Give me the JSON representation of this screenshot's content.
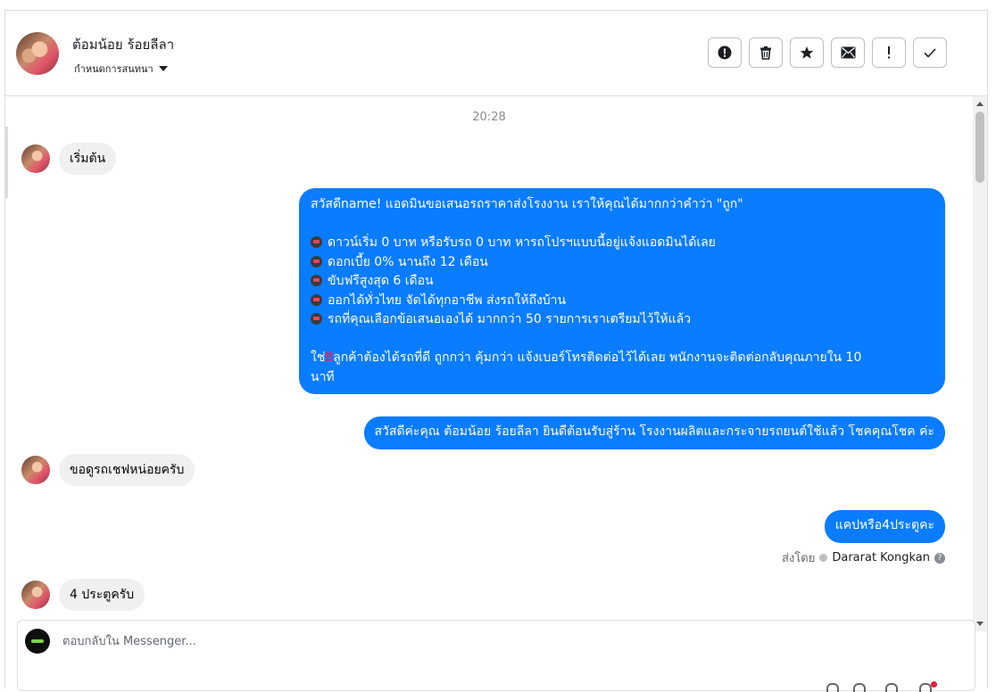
{
  "header": {
    "contact_name": "ต้อมน้อย ร้อยลีลา",
    "assign_label": "กำหนดการสนทนา",
    "actions": [
      {
        "name": "alert-icon"
      },
      {
        "name": "trash-icon"
      },
      {
        "name": "star-icon"
      },
      {
        "name": "mail-icon"
      },
      {
        "name": "exclamation-icon"
      },
      {
        "name": "check-icon"
      }
    ]
  },
  "chat": {
    "timestamp": "20:28",
    "messages": [
      {
        "dir": "in",
        "text": "เริ่มต้น"
      },
      {
        "dir": "out",
        "lines": [
          "สวัสดีname! แอดมินขอเสนอรถราคาส่งโรงงาน เราให้คุณได้มากกว่าคำว่า \"ถูก\"",
          "",
          "ดาวน์เริ่ม 0 บาท หรือรับรถ 0 บาท หารถโปรฯแบบนี้อยู่แจ้งแอดมินได้เลย",
          "ดอกเบี้ย 0% นานถึง 12 เดือน",
          "ขับฟรีสูงสุด 6 เดือน",
          "ออกได้ทั่วไทย จัดได้ทุกอาชีพ ส่งรถให้ถึงบ้าน",
          "รถที่คุณเลือกข้อเสนอเองได้ มากกว่า 50 รายการเราเตรียมไว้ให้แล้ว",
          "",
          "ใช่",
          "ลูกค้าต้องได้รถที่ดี ถูกกว่า คุ้มกว่า แจ้งเบอร์โทรติดต่อไว้ได้เลย พนักงานจะติดต่อกลับคุณภายใน 10",
          "นาที"
        ]
      },
      {
        "dir": "out",
        "text": "สวัสดีค่ะคุณ ต้อมน้อย ร้อยลีลา ยินดีต้อนรับสู่ร้าน โรงงานผลิตและกระจายรถยนต์ใช้แล้ว โชคคุณโชค ค่ะ"
      },
      {
        "dir": "in",
        "text": "ขอดูรถเชฟหน่อยครับ"
      },
      {
        "dir": "out",
        "text": "แคปหรือ4ประตูคะ"
      },
      {
        "dir": "in",
        "text": "4 ประตูครับ"
      }
    ],
    "sent_by_label": "ส่งโดย",
    "sent_by_name": "Dararat Kongkan",
    "emoji_icon": "car-emoji-icon"
  },
  "composer": {
    "placeholder": "ตอบกลับใน Messenger..."
  },
  "colors": {
    "outgoing_bubble": "#0a7cff",
    "incoming_bubble": "#f0f0f0"
  }
}
